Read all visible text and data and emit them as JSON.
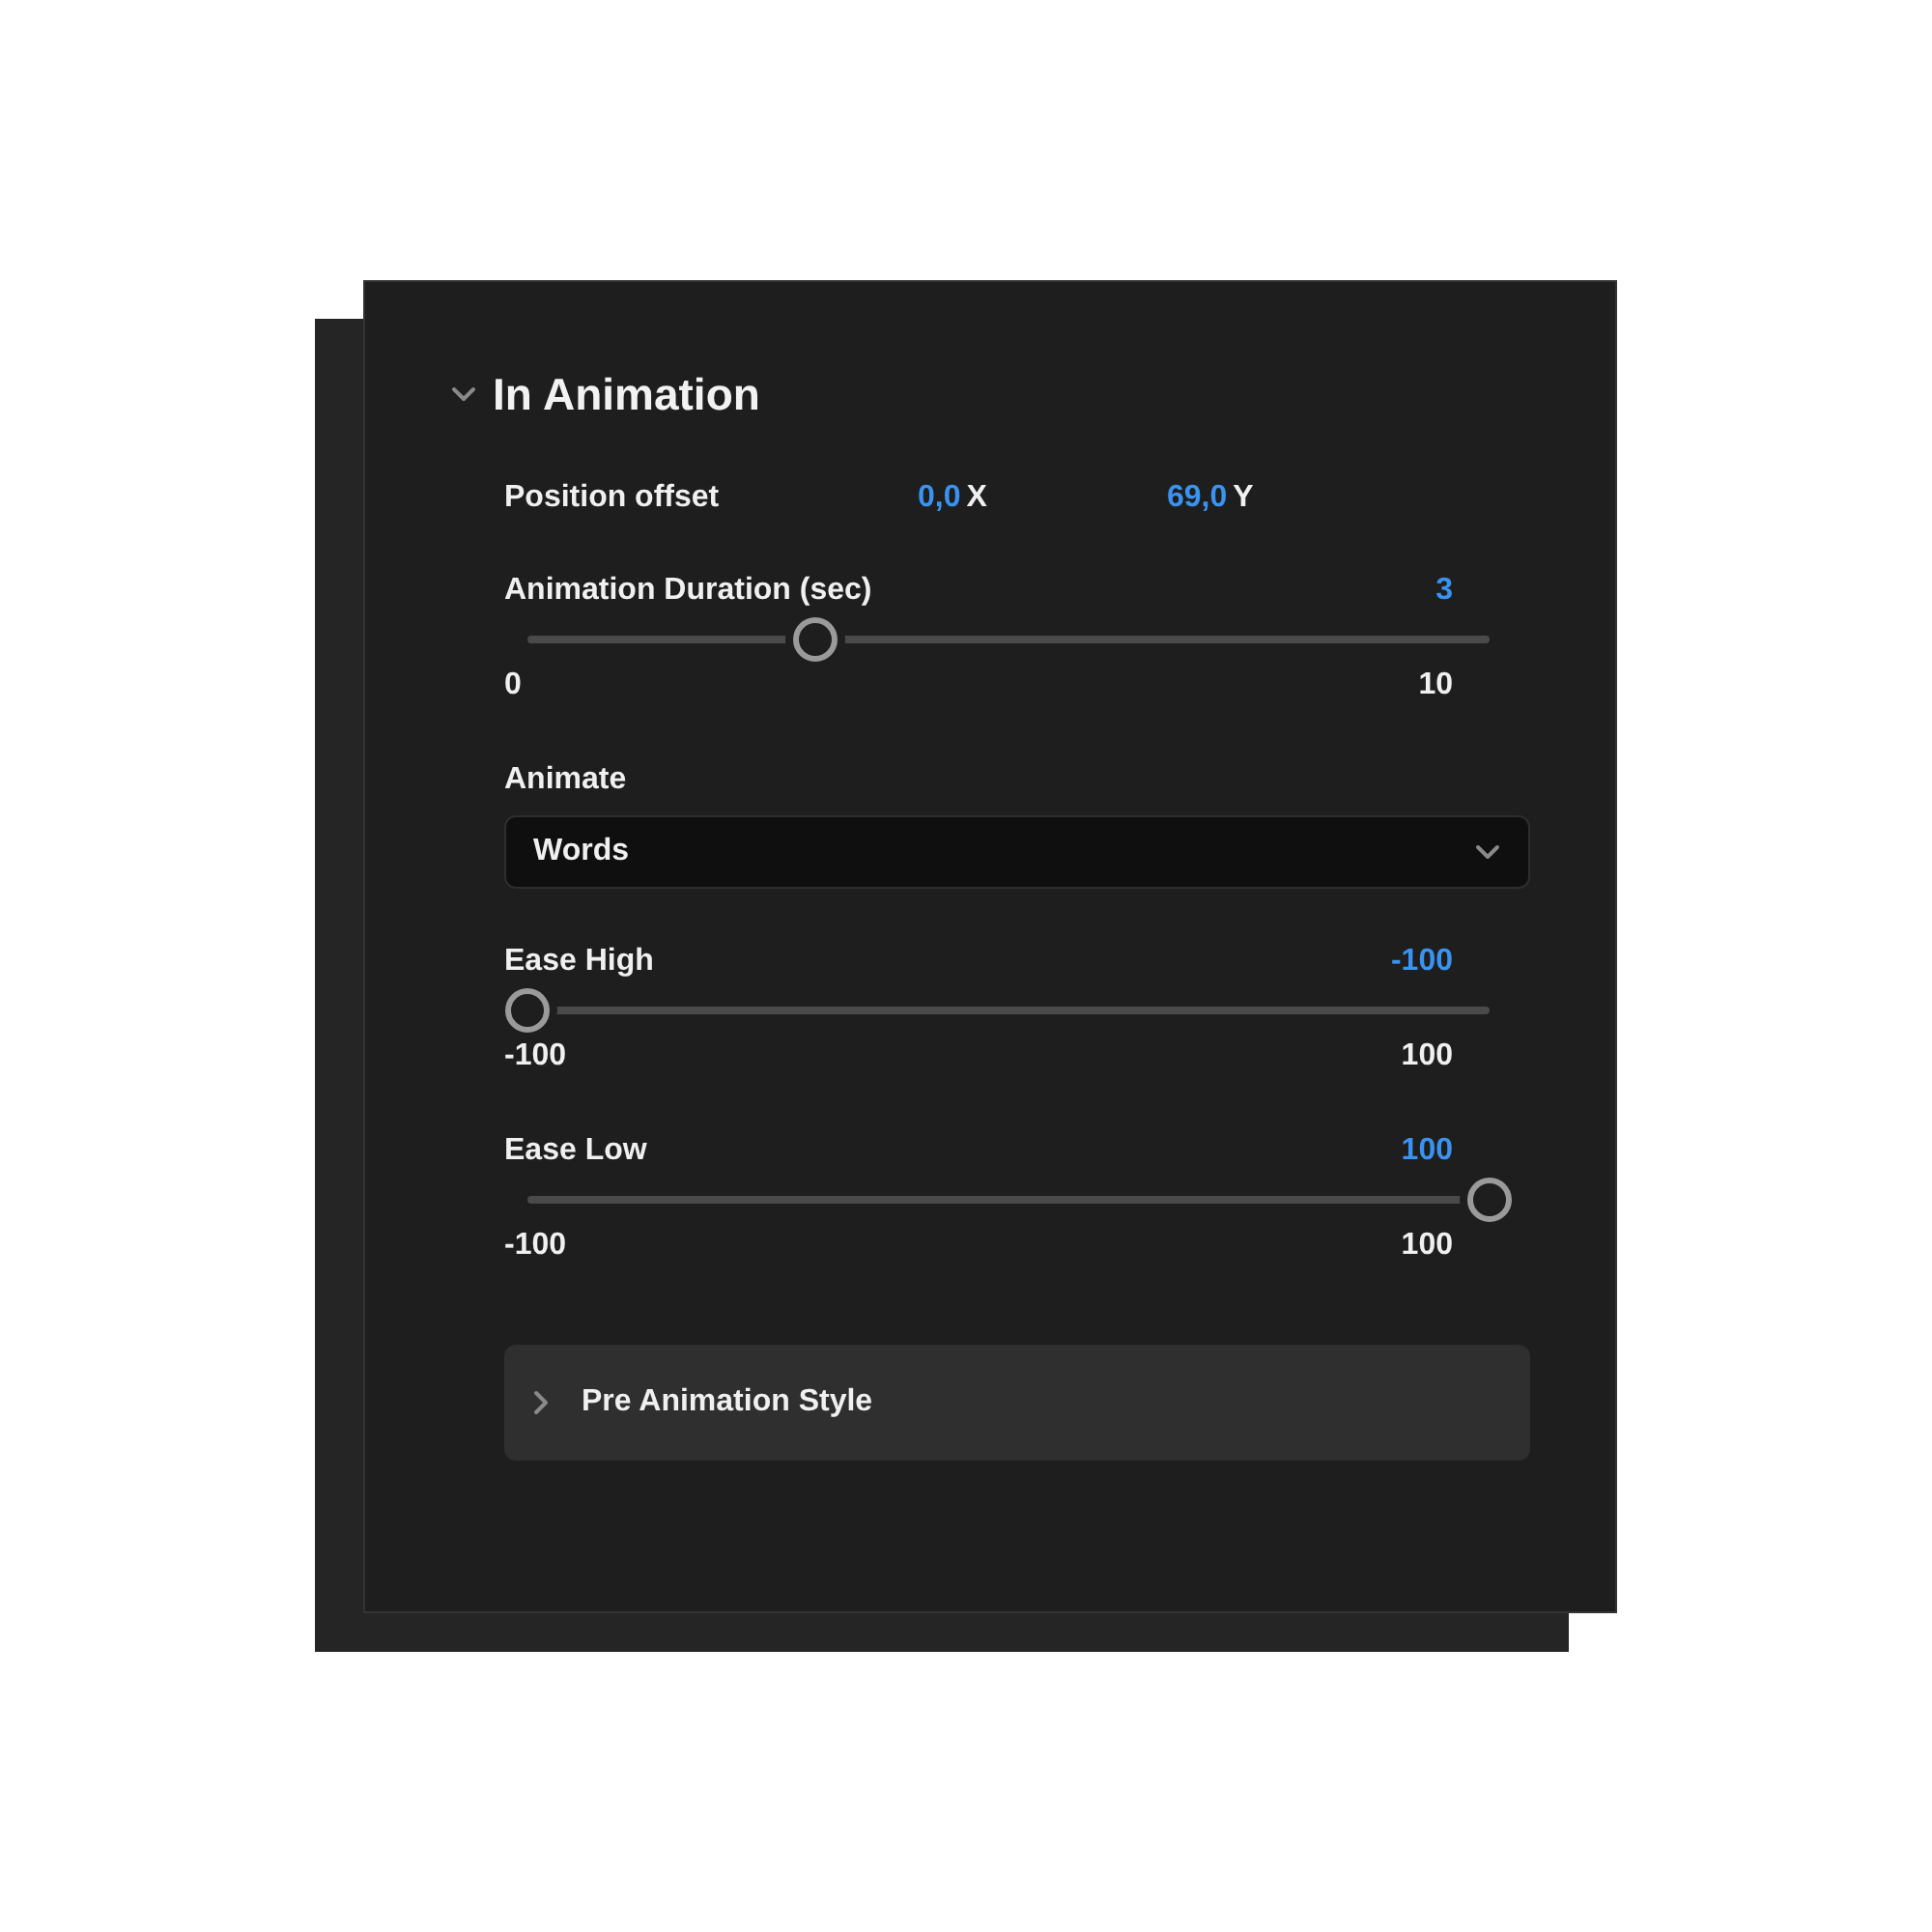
{
  "section": {
    "title": "In Animation",
    "expanded": true
  },
  "position_offset": {
    "label": "Position offset",
    "x_value": "0,0",
    "x_axis": "X",
    "y_value": "69,0",
    "y_axis": "Y"
  },
  "controls": [
    {
      "kind": "slider",
      "label": "Animation Duration (sec)",
      "value": "3",
      "level": 0.3,
      "min": "0",
      "max": "10"
    },
    {
      "kind": "dropdown",
      "label": "Animate",
      "value": "Words"
    },
    {
      "kind": "slider",
      "label": "Ease High",
      "value": "-100",
      "level": 0,
      "min": "-100",
      "max": "100"
    },
    {
      "kind": "slider",
      "label": "Ease Low",
      "value": "100",
      "level": 1,
      "min": "-100",
      "max": "100"
    }
  ],
  "subsection": {
    "title": "Pre Animation Style",
    "expanded": false
  }
}
